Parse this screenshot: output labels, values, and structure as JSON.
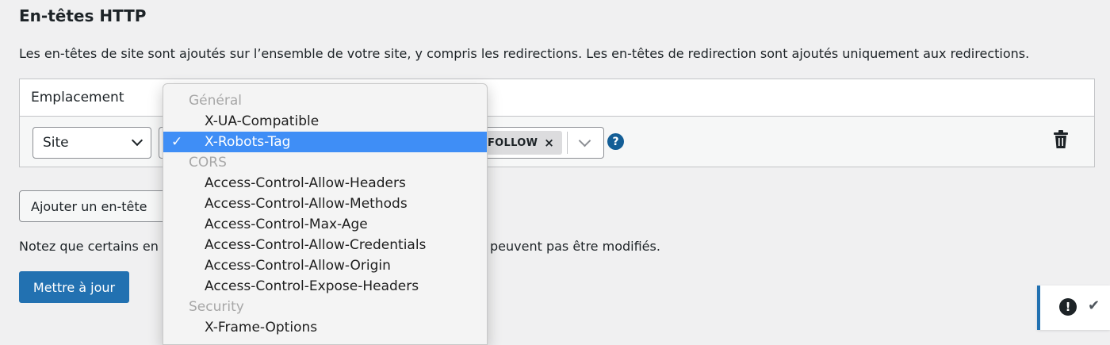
{
  "page": {
    "title": "En-têtes HTTP",
    "intro": "Les en-têtes de site sont ajoutés sur l’ensemble de votre site, y compris les redirections. Les en-têtes de redirection sont ajoutés uniquement aux redirections."
  },
  "table": {
    "header_location": "Emplacement",
    "row": {
      "location_value": "Site",
      "token_label": "FOLLOW",
      "token_remove": "×",
      "help": "?"
    }
  },
  "buttons": {
    "add_header": "Ajouter un en-tête",
    "update": "Mettre à jour"
  },
  "note": {
    "start": "Notez que certains en",
    "end": "peuvent pas être modifiés."
  },
  "dropdown": {
    "check_glyph": "✓",
    "selected": "X-Robots-Tag",
    "groups": [
      {
        "label": "Général",
        "options": [
          "X-UA-Compatible",
          "X-Robots-Tag"
        ]
      },
      {
        "label": "CORS",
        "options": [
          "Access-Control-Allow-Headers",
          "Access-Control-Allow-Methods",
          "Access-Control-Max-Age",
          "Access-Control-Allow-Credentials",
          "Access-Control-Allow-Origin",
          "Access-Control-Expose-Headers"
        ]
      },
      {
        "label": "Security",
        "options": [
          "X-Frame-Options"
        ]
      }
    ]
  },
  "toast": {
    "alert_glyph": "!",
    "check_glyph": "✔"
  },
  "colors": {
    "primary": "#2271b1",
    "selection": "#3f8ef6",
    "help": "#135e96"
  }
}
